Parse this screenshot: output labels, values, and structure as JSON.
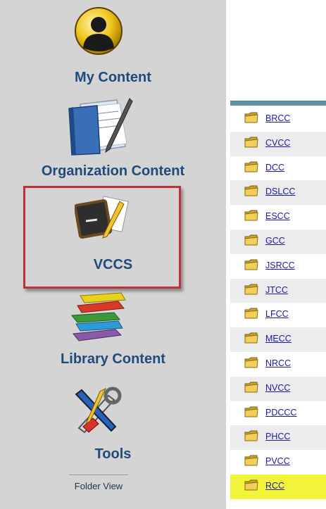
{
  "nav": {
    "items": [
      {
        "label": "My Content",
        "icon": "user-silhouette-icon"
      },
      {
        "label": "Organization Content",
        "icon": "book-icon"
      },
      {
        "label": "VCCS",
        "icon": "chalkboard-icon"
      },
      {
        "label": "Library Content",
        "icon": "book-stack-icon"
      },
      {
        "label": "Tools",
        "icon": "tools-icon"
      }
    ],
    "folder_view": "Folder View",
    "selected_box_color": "#c0303a"
  },
  "folders": [
    "BRCC",
    "CVCC",
    "DCC",
    "DSLCC",
    "ESCC",
    "GCC",
    "JSRCC",
    "JTCC",
    "LFCC",
    "MECC",
    "NRCC",
    "NVCC",
    "PDCCC",
    "PHCC",
    "PVCC",
    "RCC"
  ],
  "highlighted_folder": "RCC",
  "colors": {
    "nav_background": "#d4d4d4",
    "nav_label": "#1f4a7a",
    "link": "#1a1aa6",
    "highlight": "#f2f53a",
    "list_header": "#5f94a8"
  }
}
